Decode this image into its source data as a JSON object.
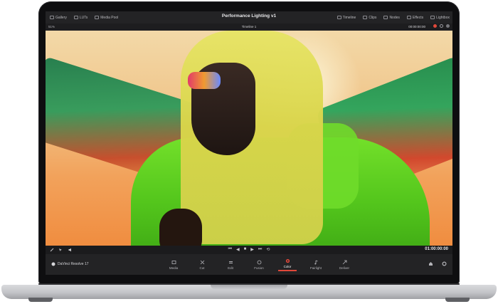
{
  "app": {
    "title": "Performance Lighting v1"
  },
  "topbar": {
    "left_items": [
      {
        "label": "Gallery",
        "icon": "gallery-icon"
      },
      {
        "label": "LUTs",
        "icon": "luts-icon"
      },
      {
        "label": "Media Pool",
        "icon": "media-pool-icon"
      }
    ],
    "right_items": [
      {
        "label": "Timeline",
        "icon": "timeline-icon"
      },
      {
        "label": "Clips",
        "icon": "clips-icon"
      },
      {
        "label": "Nodes",
        "icon": "nodes-icon"
      },
      {
        "label": "Effects",
        "icon": "effects-icon"
      },
      {
        "label": "Lightbox",
        "icon": "lightbox-icon"
      }
    ]
  },
  "subbar": {
    "zoom": "51%",
    "timeline_name": "Timeline 1",
    "timecode": "00:00:00:00"
  },
  "transport": {
    "timecode": "01:00:00:00",
    "controls": [
      "skip-back-icon",
      "step-back-icon",
      "stop-icon",
      "play-icon",
      "skip-forward-icon",
      "loop-icon"
    ]
  },
  "pagebar": {
    "brand": "DaVinci Resolve 17",
    "pages": [
      {
        "label": "Media",
        "icon": "media-page-icon",
        "active": false
      },
      {
        "label": "Cut",
        "icon": "cut-page-icon",
        "active": false
      },
      {
        "label": "Edit",
        "icon": "edit-page-icon",
        "active": false
      },
      {
        "label": "Fusion",
        "icon": "fusion-page-icon",
        "active": false
      },
      {
        "label": "Color",
        "icon": "color-page-icon",
        "active": true
      },
      {
        "label": "Fairlight",
        "icon": "fairlight-page-icon",
        "active": false
      },
      {
        "label": "Deliver",
        "icon": "deliver-page-icon",
        "active": false
      }
    ]
  },
  "colors": {
    "accent": "#e0483a",
    "ui_dark": "#232325"
  }
}
